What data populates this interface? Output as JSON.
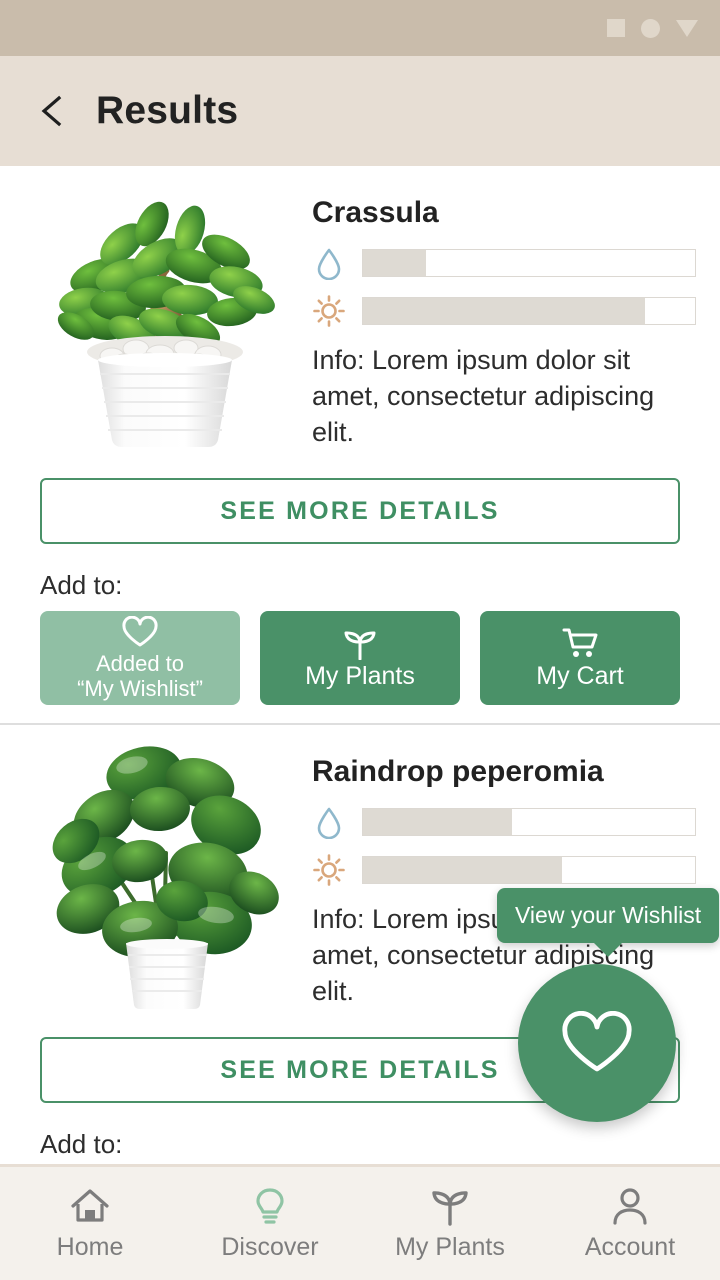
{
  "status_bar": {
    "icons": [
      "square-icon",
      "circle-icon",
      "triangle-down-icon"
    ],
    "background_color": "#c9bcab"
  },
  "app_bar": {
    "back_icon": "chevron-left-icon",
    "title": "Results",
    "background_color": "#e7ded4"
  },
  "theme": {
    "primary_green": "#4a9168",
    "muted_green": "#90bfa4",
    "water_blue": "#8fb8cc",
    "sun_orange": "#d9a77c",
    "meter_fill": "#dedad3"
  },
  "common": {
    "details_label": "SEE MORE DETAILS",
    "add_to_label": "Add to:",
    "water_icon": "water-drop-icon",
    "sun_icon": "sun-icon"
  },
  "cards": [
    {
      "name": "Crassula",
      "image_alt": "crassula-jade-plant-in-white-pot",
      "water_level": 19,
      "sun_level": 85,
      "description": "Info: Lorem ipsum dolor sit amet, consectetur adipiscing elit.",
      "details_label": "SEE MORE DETAILS",
      "add_to_label": "Add to:",
      "actions": [
        {
          "icon": "heart-icon",
          "label": "Added to\n“My Wishlist”",
          "label_line1": "Added to",
          "label_line2": "“My Wishlist”",
          "state": "added"
        },
        {
          "icon": "sprout-icon",
          "label": "My Plants",
          "state": "default"
        },
        {
          "icon": "shopping-cart-icon",
          "label": "My Cart",
          "state": "default"
        }
      ]
    },
    {
      "name": "Raindrop peperomia",
      "image_alt": "raindrop-peperomia-in-white-pot",
      "water_level": 45,
      "sun_level": 60,
      "description": "Info: Lorem ipsum dolor sit amet, consectetur adipiscing elit.",
      "details_label": "SEE MORE DETAILS",
      "add_to_label": "Add to:",
      "actions": []
    }
  ],
  "fab": {
    "icon": "heart-icon",
    "tooltip": "View your Wishlist"
  },
  "bottom_nav": {
    "items": [
      {
        "icon": "home-icon",
        "label": "Home",
        "active": false
      },
      {
        "icon": "lightbulb-icon",
        "label": "Discover",
        "active": true
      },
      {
        "icon": "sprout-icon",
        "label": "My Plants",
        "active": false
      },
      {
        "icon": "person-icon",
        "label": "Account",
        "active": false
      }
    ]
  }
}
